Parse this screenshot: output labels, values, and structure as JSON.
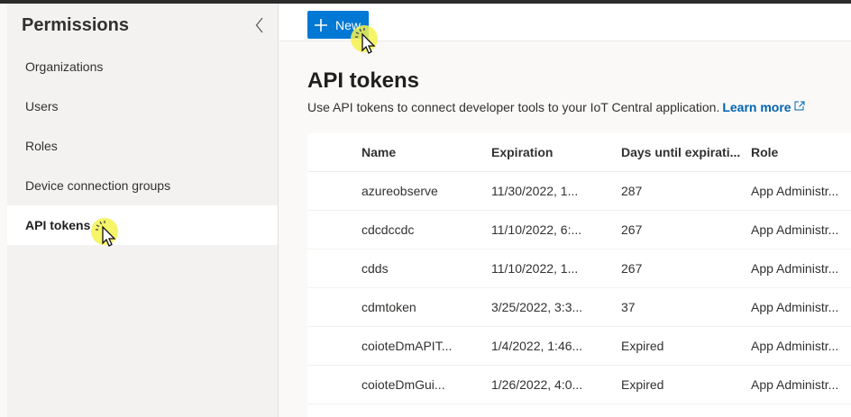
{
  "sidebar": {
    "title": "Permissions",
    "items": [
      {
        "label": "Organizations",
        "active": false
      },
      {
        "label": "Users",
        "active": false
      },
      {
        "label": "Roles",
        "active": false
      },
      {
        "label": "Device connection groups",
        "active": false
      },
      {
        "label": "API tokens",
        "active": true
      }
    ]
  },
  "toolbar": {
    "new_label": "New"
  },
  "main": {
    "title": "API tokens",
    "description": "Use API tokens to connect developer tools to your IoT Central application.",
    "learn_more": "Learn more"
  },
  "table": {
    "columns": [
      "Name",
      "Expiration",
      "Days until expirati...",
      "Role"
    ],
    "rows": [
      {
        "name": "azureobserve",
        "expiration": "11/30/2022, 1...",
        "days": "287",
        "role": "App Administr..."
      },
      {
        "name": "cdcdccdc",
        "expiration": "11/10/2022, 6:...",
        "days": "267",
        "role": "App Administr..."
      },
      {
        "name": "cdds",
        "expiration": "11/10/2022, 1...",
        "days": "267",
        "role": "App Administr..."
      },
      {
        "name": "cdmtoken",
        "expiration": "3/25/2022, 3:3...",
        "days": "37",
        "role": "App Administr..."
      },
      {
        "name": "coioteDmAPIT...",
        "expiration": "1/4/2022, 1:46...",
        "days": "Expired",
        "role": "App Administr..."
      },
      {
        "name": "coioteDmGui...",
        "expiration": "1/26/2022, 4:0...",
        "days": "Expired",
        "role": "App Administr..."
      }
    ]
  },
  "colors": {
    "accent": "#0078d4",
    "link": "#0063b1",
    "cursor_highlight": "#f5f24f"
  },
  "icons": [
    "collapse-chevron-icon",
    "plus-icon",
    "external-link-icon",
    "cursor-icon"
  ]
}
